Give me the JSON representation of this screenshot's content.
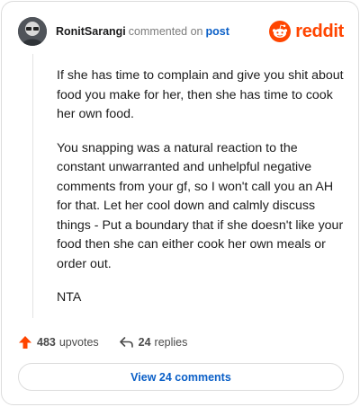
{
  "header": {
    "username": "RonitSarangi",
    "action_text": "commented on",
    "post_link": "post",
    "brand": "reddit"
  },
  "comment": {
    "paragraphs": [
      "If she has time to complain and give you shit about food you make for her, then she has time to cook her own food.",
      "You snapping was a natural reaction to the constant unwarranted and unhelpful negative comments from your gf, so I won't call you an AH for that. Let her cool down and calmly discuss things - Put a boundary that if she doesn't like your food then she can either cook her own meals or order out.",
      "NTA"
    ]
  },
  "actions": {
    "upvotes_count": "483",
    "upvotes_label": "upvotes",
    "replies_count": "24",
    "replies_label": "replies"
  },
  "view_button": {
    "label": "View 24 comments"
  },
  "colors": {
    "brand_orange": "#ff4500",
    "link_blue": "#0a5fc7"
  }
}
